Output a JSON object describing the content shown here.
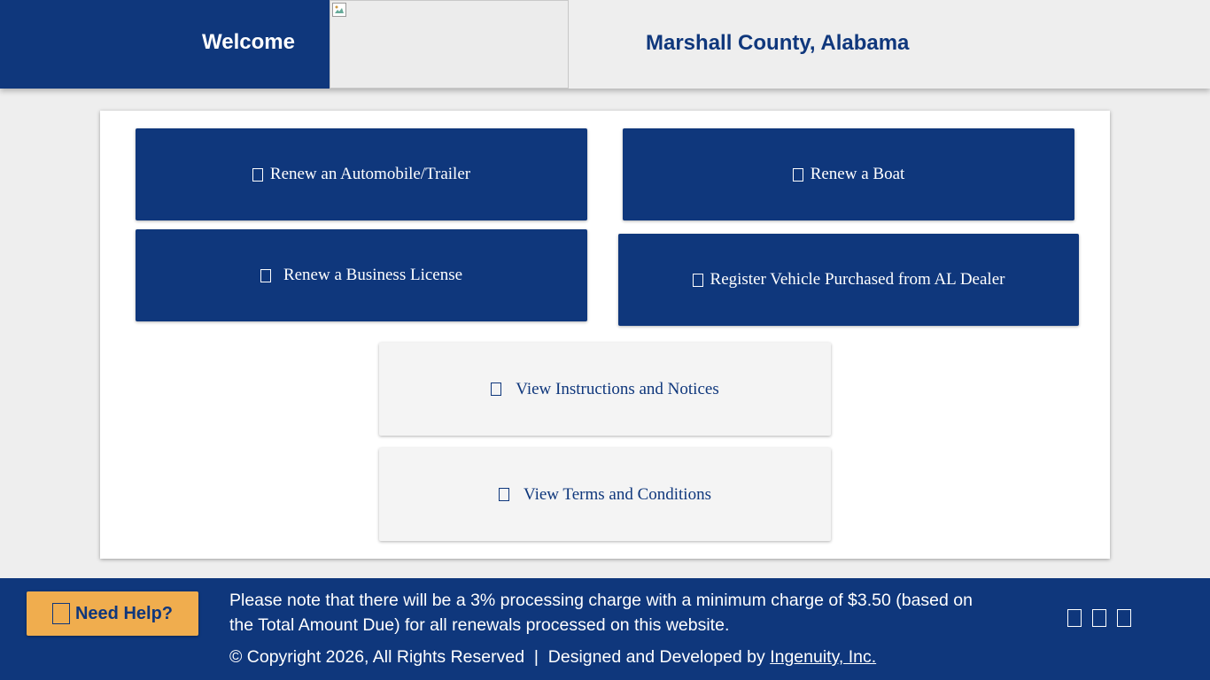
{
  "header": {
    "welcome": "Welcome",
    "county": "Marshall County, Alabama",
    "logo_icon": "broken-image-icon"
  },
  "tiles": {
    "auto": {
      "label": "Renew an Automobile/Trailer",
      "icon": "car-icon"
    },
    "boat": {
      "label": "Renew a Boat",
      "icon": "ship-icon"
    },
    "business": {
      "label": "Renew a Business License",
      "icon": "briefcase-icon"
    },
    "register": {
      "label": "Register Vehicle Purchased from AL Dealer",
      "icon": "car-icon"
    },
    "instructions": {
      "label": "View Instructions and Notices",
      "icon": "info-icon"
    },
    "terms": {
      "label": "View Terms and Conditions",
      "icon": "file-icon"
    }
  },
  "footer": {
    "help_label": "Need Help?",
    "help_icon": "question-icon",
    "notice": "Please note that there will be a 3% processing charge with a minimum charge of $3.50 (based on the Total Amount Due) for all renewals processed on this website.",
    "copyright_prefix": "© Copyright 2026, All Rights Reserved  |  Designed and Developed by ",
    "developer_link": "Ingenuity, Inc.",
    "social_icons": [
      "facebook-icon",
      "twitter-icon",
      "instagram-icon"
    ]
  },
  "colors": {
    "brand_blue": "#0f377c",
    "accent_orange": "#f0ad4e",
    "page_bg": "#eeeeee"
  }
}
